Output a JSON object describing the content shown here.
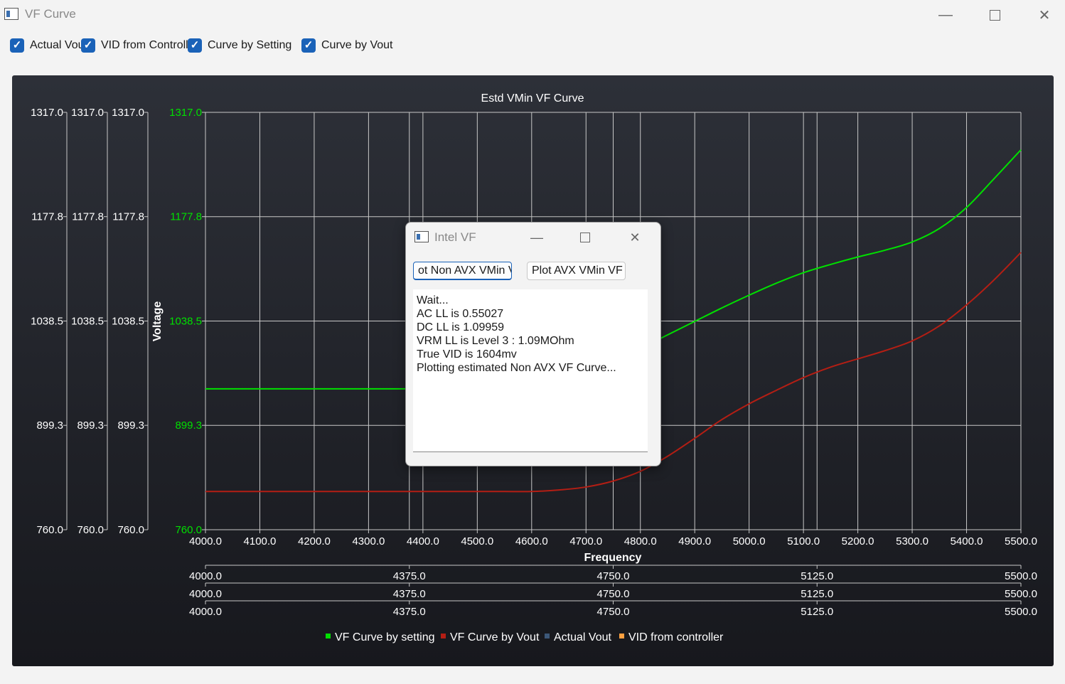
{
  "window": {
    "title": "VF Curve",
    "minimize_icon": "minimize-icon",
    "maximize_icon": "maximize-icon",
    "close_icon": "close-icon"
  },
  "toolbar": {
    "checkboxes": [
      {
        "label": "Actual Vout",
        "checked": true
      },
      {
        "label": "VID from Controller",
        "checked": true
      },
      {
        "label": "Curve by Setting",
        "checked": true
      },
      {
        "label": "Curve by Vout",
        "checked": true
      }
    ]
  },
  "chart_data": {
    "type": "line",
    "title": "Estd VMin VF Curve",
    "xlabel": "Frequency",
    "ylabel": "Voltage",
    "xlim": [
      4000,
      5500
    ],
    "ylim": [
      760,
      1317
    ],
    "x_ticks": [
      "4000.0",
      "4100.0",
      "4200.0",
      "4300.0",
      "4400.0",
      "4500.0",
      "4600.0",
      "4700.0",
      "4800.0",
      "4900.0",
      "5000.0",
      "5100.0",
      "5200.0",
      "5300.0",
      "5400.0",
      "5500.0"
    ],
    "secondary_x_ticks": [
      "4000.0",
      "4375.0",
      "4750.0",
      "5125.0",
      "5500.0"
    ],
    "y_ticks": [
      "1317.0",
      "1177.8",
      "1038.5",
      "899.3",
      "760.0"
    ],
    "grid": true,
    "legend_position": "bottom",
    "series": [
      {
        "name": "VF Curve by setting",
        "color": "#00e000",
        "x": [
          4000,
          4100,
          4200,
          4300,
          4375,
          4400,
          4500,
          4600,
          4700,
          4750,
          4800,
          4850,
          4900,
          4950,
          5000,
          5050,
          5100,
          5150,
          5200,
          5250,
          5300,
          5350,
          5400,
          5450,
          5500
        ],
        "y": [
          948,
          948,
          948,
          948,
          948,
          948,
          953,
          960,
          975,
          987,
          1002,
          1020,
          1038,
          1056,
          1073,
          1089,
          1103,
          1114,
          1124,
          1133,
          1144,
          1162,
          1190,
          1228,
          1267
        ]
      },
      {
        "name": "VF Curve by Vout",
        "color": "#b41e14",
        "x": [
          4000,
          4100,
          4200,
          4300,
          4400,
          4500,
          4550,
          4600,
          4650,
          4700,
          4750,
          4800,
          4850,
          4900,
          4950,
          5000,
          5050,
          5100,
          5150,
          5200,
          5250,
          5300,
          5350,
          5400,
          5450,
          5500
        ],
        "y": [
          811,
          811,
          811,
          811,
          811,
          811,
          811,
          811,
          813,
          817,
          825,
          838,
          858,
          882,
          907,
          928,
          946,
          963,
          977,
          988,
          999,
          1012,
          1032,
          1060,
          1093,
          1130
        ]
      },
      {
        "name": "Actual Vout",
        "color": "#3c5878",
        "x": [],
        "y": []
      },
      {
        "name": "VID from controller",
        "color": "#ffa040",
        "x": [],
        "y": []
      }
    ]
  },
  "dialog": {
    "title": "Intel VF",
    "button_non_avx": "ot Non AVX VMin V",
    "button_avx": "Plot AVX VMin VF",
    "log_lines": [
      "Wait...",
      "AC LL is 0.55027",
      "DC LL is 1.09959",
      "VRM LL is Level 3 : 1.09MOhm",
      "True VID is 1604mv",
      "Plotting estimated Non AVX VF Curve..."
    ]
  }
}
